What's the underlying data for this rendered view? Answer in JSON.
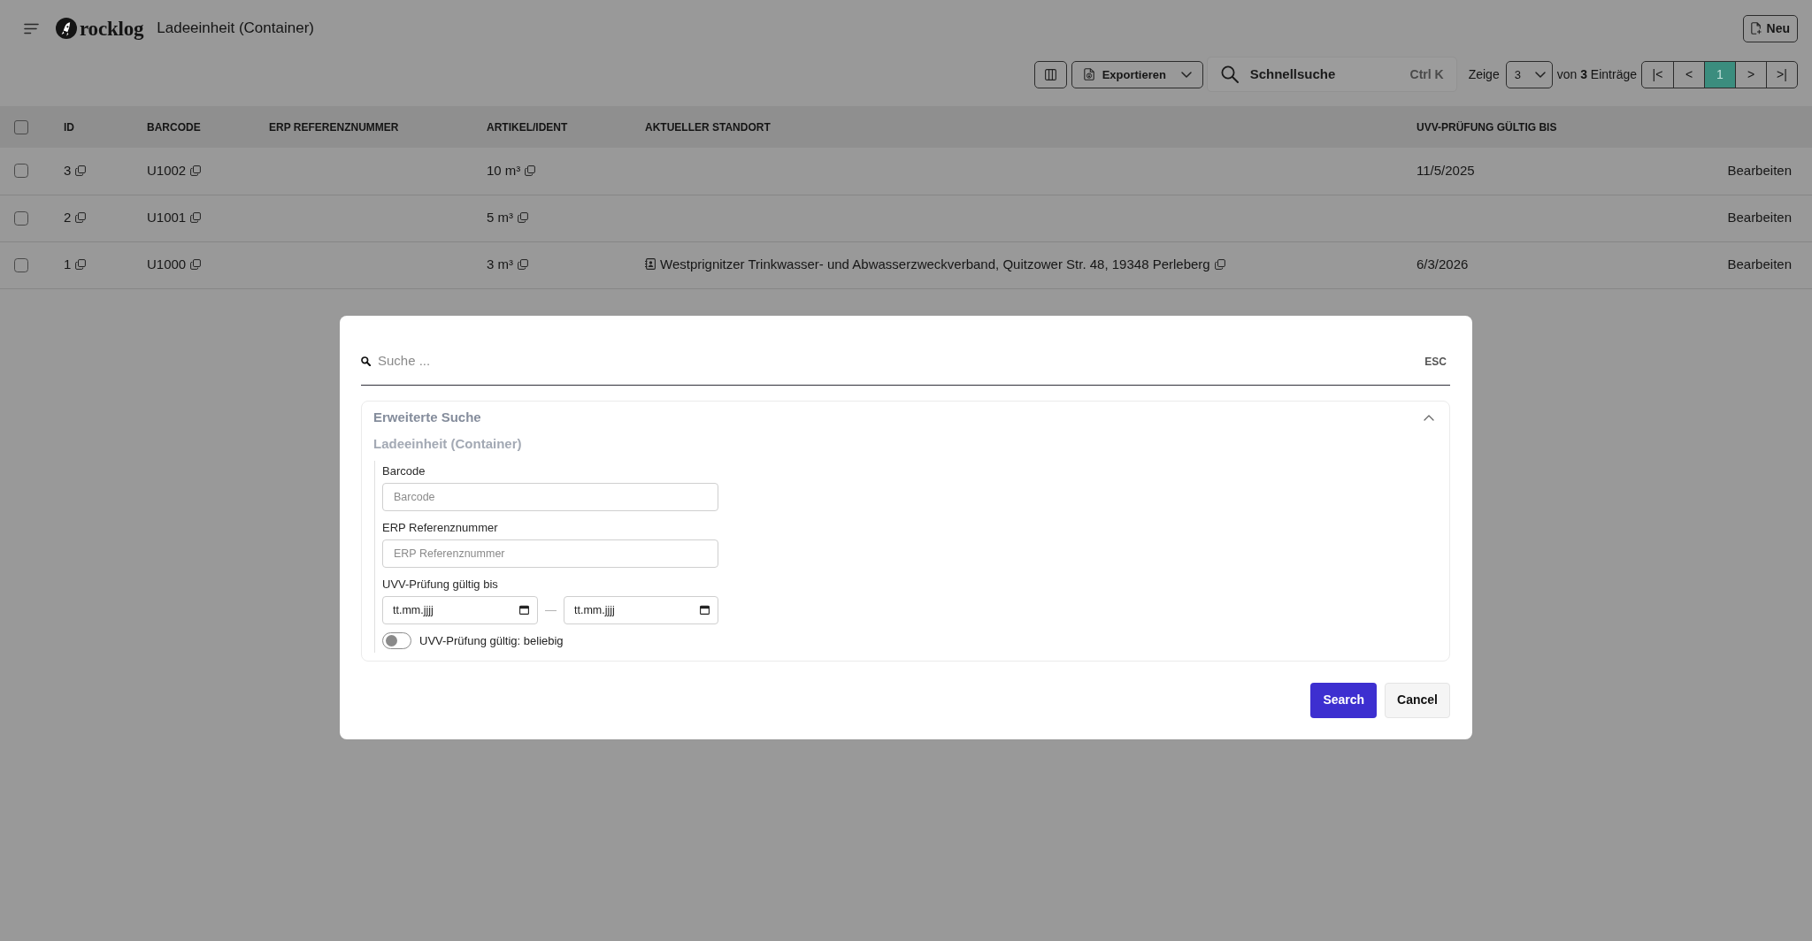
{
  "header": {
    "logo_text": "rocklog",
    "title": "Ladeeinheit (Container)",
    "new_button": "Neu"
  },
  "toolbar": {
    "export_button": "Exportieren",
    "quick_search": {
      "label": "Schnellsuche",
      "shortcut": "Ctrl K"
    },
    "page_size": {
      "label": "Zeige",
      "value": "3"
    },
    "entries_text": "von **3** Einträge",
    "pagination": [
      {
        "label": "|<",
        "selected": false
      },
      {
        "label": "<",
        "selected": false
      },
      {
        "label": "1",
        "selected": true
      },
      {
        "label": ">",
        "selected": false
      },
      {
        "label": ">|",
        "selected": false
      }
    ]
  },
  "table": {
    "select_all_checked": false,
    "columns": [
      "ID",
      "BARCODE",
      "ERP REFERENZNUMMER",
      "ARTIKEL/IDENT",
      "AKTUELLER STANDORT",
      "UVV-PRÜFUNG GÜLTIG BIS"
    ],
    "rows": [
      {
        "checked": false,
        "id": "3",
        "barcode": "U1002",
        "article": "10 m³",
        "uvv_valid_until": "11/5/2025",
        "action": "Bearbeiten"
      },
      {
        "checked": false,
        "id": "2",
        "barcode": "U1001",
        "article": "5 m³",
        "action": "Bearbeiten"
      },
      {
        "checked": false,
        "id": "1",
        "barcode": "U1000",
        "article": "3 m³",
        "location": "Westprignitzer Trinkwasser- und Abwasserzweckverband, Quitzower Str. 48, 19348 Perleberg",
        "uvv_valid_until": "6/3/2026",
        "action": "Bearbeiten"
      }
    ]
  },
  "search_dialog": {
    "search": {
      "placeholder": "Suche ...",
      "shortcut": "ESC"
    },
    "advanced_search": {
      "title": "Erweiterte Suche",
      "expanded": true,
      "section_title": "Ladeeinheit (Container)",
      "fields": [
        {
          "kind": "text",
          "label": "Barcode",
          "placeholder": "Barcode"
        },
        {
          "kind": "text",
          "label": "ERP Referenznummer",
          "placeholder": "ERP Referenznummer"
        },
        {
          "kind": "date_range",
          "label": "UVV-Prüfung gültig bis",
          "from_placeholder": "tt.mm.jjjj",
          "separator": "—",
          "to_placeholder": "tt.mm.jjjj"
        },
        {
          "kind": "toggle",
          "label": "UVV-Prüfung gültig: beliebig",
          "on": false
        }
      ]
    },
    "buttons": [
      {
        "kind": "primary",
        "label": "Search"
      },
      {
        "kind": "secondary",
        "label": "Cancel"
      }
    ]
  }
}
